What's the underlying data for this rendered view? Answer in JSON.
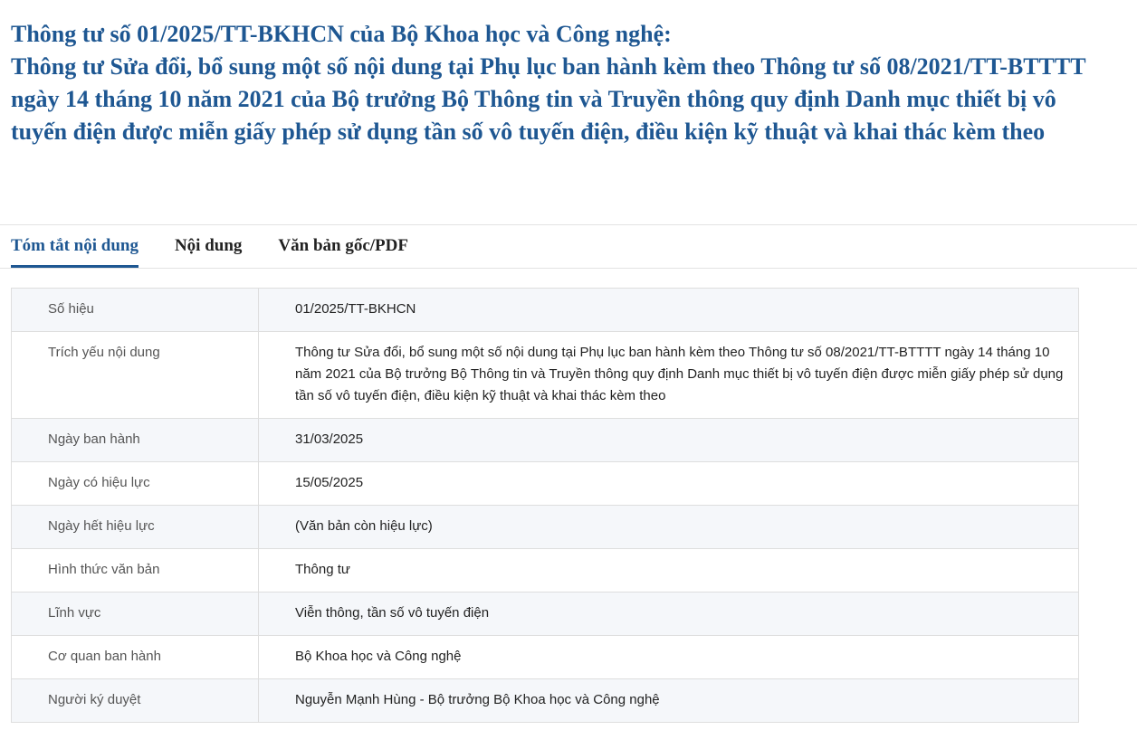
{
  "title": {
    "line1": "Thông tư số 01/2025/TT-BKHCN của Bộ Khoa học và Công nghệ:",
    "line2": "Thông tư Sửa đổi, bổ sung một số nội dung tại Phụ lục ban hành kèm theo Thông tư số 08/2021/TT-BTTTT ngày 14 tháng 10 năm 2021 của Bộ trưởng Bộ Thông tin và Truyền thông quy định Danh mục thiết bị vô tuyến điện được miễn giấy phép sử dụng tần số vô tuyến điện, điều kiện kỹ thuật và khai thác kèm theo"
  },
  "tabs": [
    {
      "label": "Tóm tắt nội dung",
      "active": true
    },
    {
      "label": "Nội dung",
      "active": false
    },
    {
      "label": "Văn bản gốc/PDF",
      "active": false
    }
  ],
  "accent_color": "#1e5792",
  "rows": [
    {
      "label": "Số hiệu",
      "value": "01/2025/TT-BKHCN"
    },
    {
      "label": "Trích yếu nội dung",
      "value": "Thông tư Sửa đổi, bổ sung một số nội dung tại Phụ lục ban hành kèm theo Thông tư số 08/2021/TT-BTTTT ngày 14 tháng 10 năm 2021 của Bộ trưởng Bộ Thông tin và Truyền thông quy định Danh mục thiết bị vô tuyến điện được miễn giấy phép sử dụng tần số vô tuyến điện, điều kiện kỹ thuật và khai thác kèm theo"
    },
    {
      "label": "Ngày ban hành",
      "value": "31/03/2025"
    },
    {
      "label": "Ngày có hiệu lực",
      "value": "15/05/2025"
    },
    {
      "label": "Ngày hết hiệu lực",
      "value": "(Văn bản còn hiệu lực)"
    },
    {
      "label": "Hình thức văn bản",
      "value": "Thông tư"
    },
    {
      "label": "Lĩnh vực",
      "value": "Viễn thông, tần số vô tuyến điện"
    },
    {
      "label": "Cơ quan ban hành",
      "value": "Bộ Khoa học và Công nghệ"
    },
    {
      "label": "Người ký duyệt",
      "value": "Nguyễn Mạnh Hùng - Bộ trưởng Bộ Khoa học và Công nghệ"
    }
  ]
}
